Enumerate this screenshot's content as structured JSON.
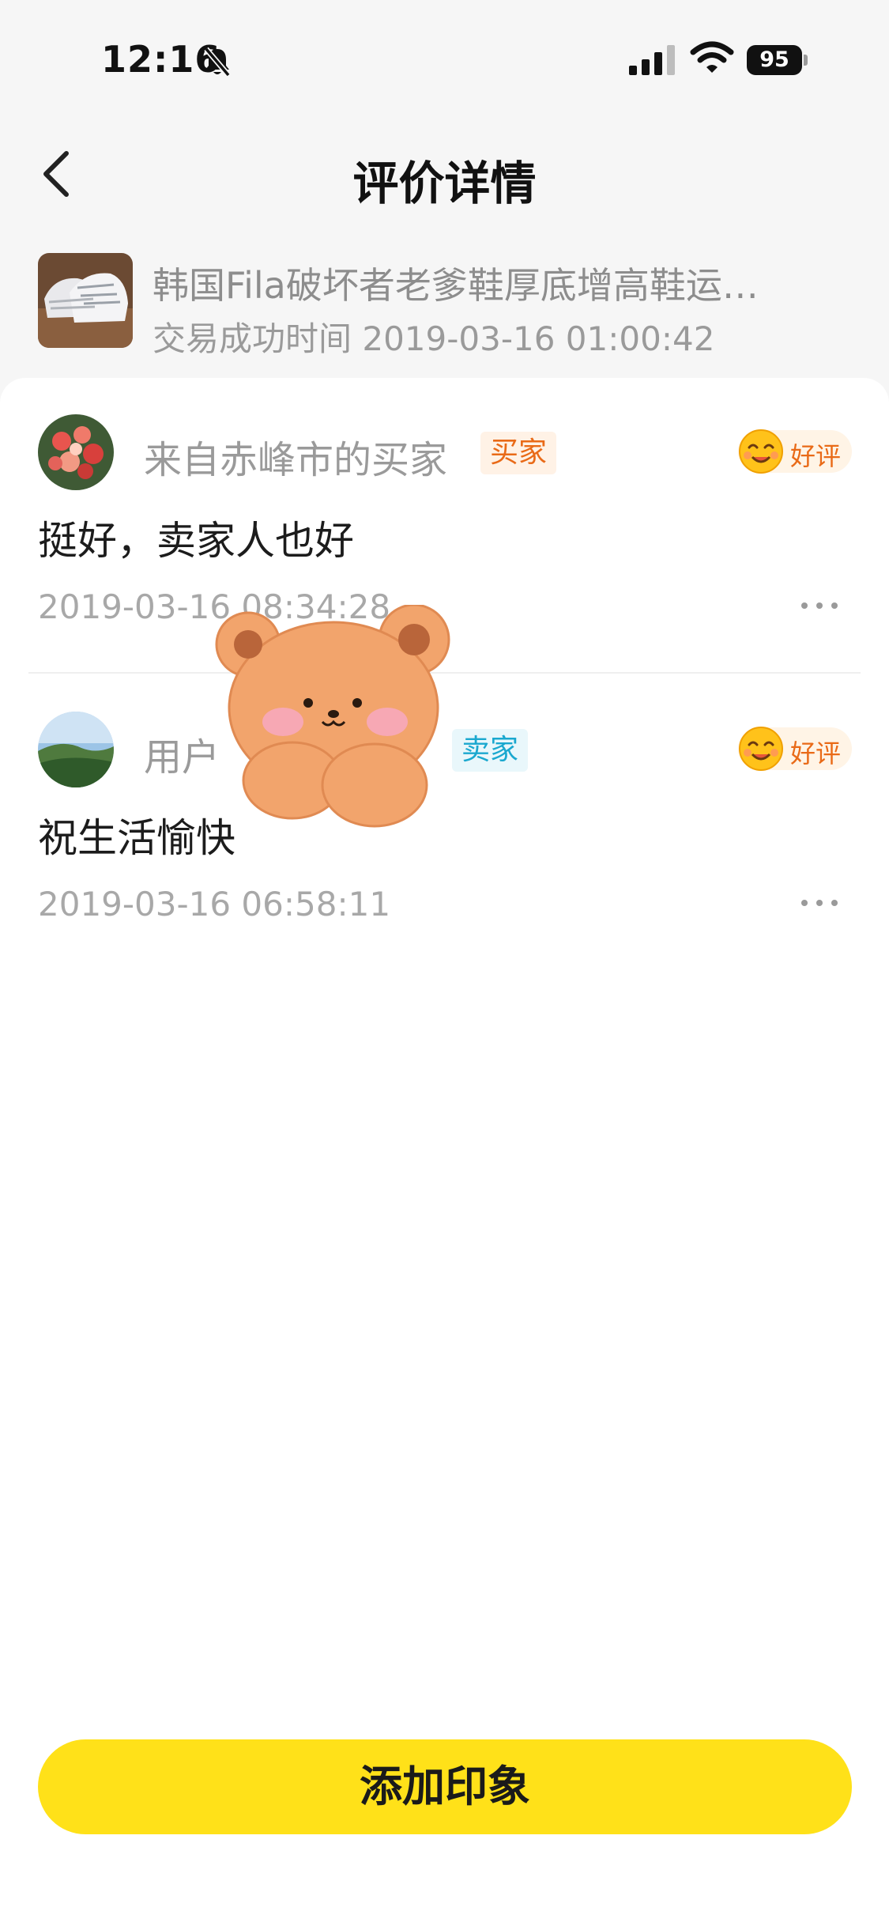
{
  "status_bar": {
    "time": "12:16",
    "battery": "95"
  },
  "nav": {
    "title": "评价详情"
  },
  "product": {
    "name": "韩国Fila破坏者老爹鞋厚底增高鞋运…",
    "deal_time": "交易成功时间 2019-03-16 01:00:42"
  },
  "reviews": [
    {
      "user": "来自赤峰市的买家",
      "role": "买家",
      "rating": "好评",
      "comment": "挺好，卖家人也好",
      "time": "2019-03-16 08:34:28"
    },
    {
      "user": "用户",
      "role": "卖家",
      "rating": "好评",
      "comment": "祝生活愉快",
      "time": "2019-03-16 06:58:11"
    }
  ],
  "actions": {
    "add_impression": "添加印象"
  },
  "colors": {
    "accent_yellow": "#ffe119",
    "buyer_badge": "#e96a17",
    "seller_badge": "#1aa8cf"
  },
  "icons": [
    "bell-slash-icon",
    "signal-icon",
    "wifi-icon",
    "battery-icon",
    "back-arrow-icon",
    "smile-emoji-icon",
    "more-dots-icon",
    "bear-sticker"
  ]
}
